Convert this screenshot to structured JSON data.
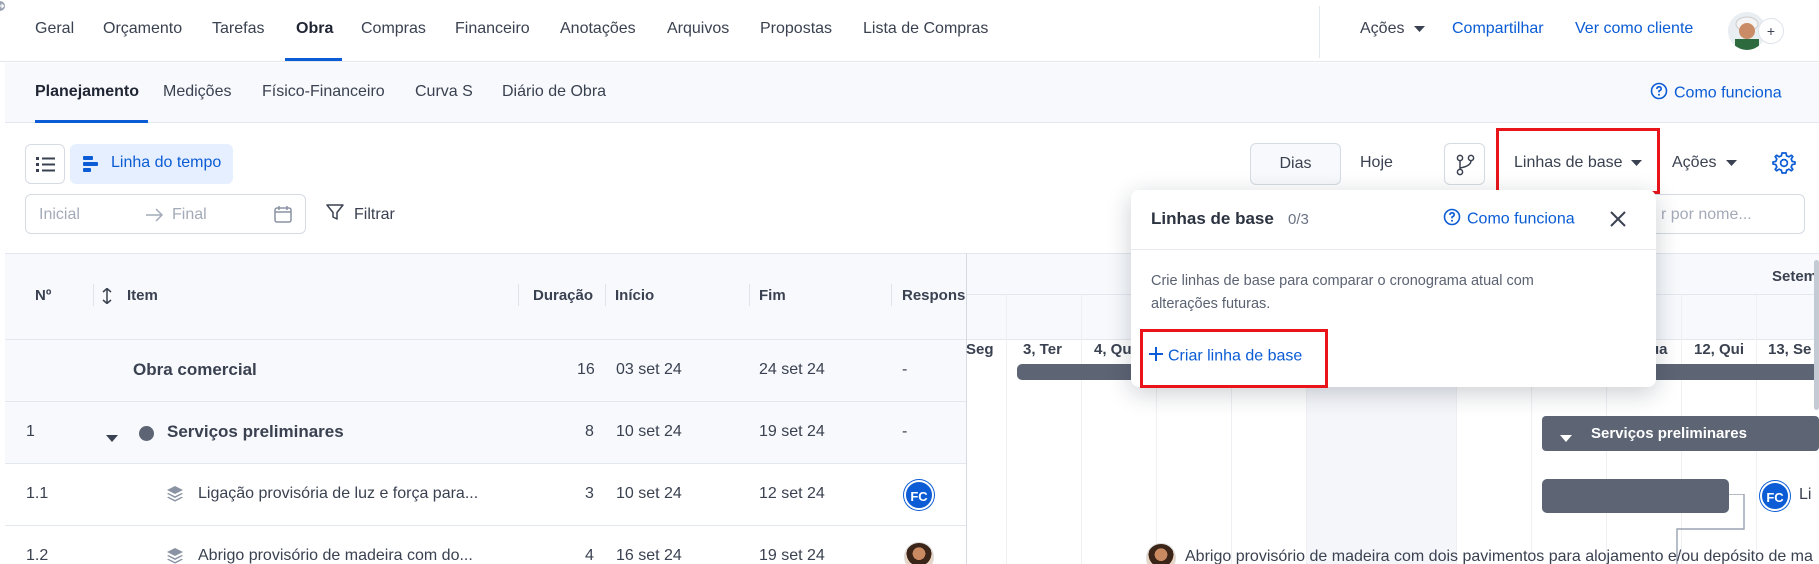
{
  "top_nav": {
    "tabs": [
      "Geral",
      "Orçamento",
      "Tarefas",
      "Obra",
      "Compras",
      "Financeiro",
      "Anotações",
      "Arquivos",
      "Propostas",
      "Lista de Compras"
    ],
    "actions_label": "Ações",
    "share_label": "Compartilhar",
    "view_as_client_label": "Ver como cliente",
    "add_symbol": "+"
  },
  "sub_nav": {
    "tabs": [
      "Planejamento",
      "Medições",
      "Físico-Financeiro",
      "Curva S",
      "Diário de Obra"
    ],
    "how_it_works": "Como funciona"
  },
  "toolbar": {
    "timeline_label": "Linha do tempo",
    "date_start_placeholder": "Inicial",
    "date_end_placeholder": "Final",
    "filter_label": "Filtrar",
    "days_label": "Dias",
    "today_label": "Hoje",
    "baselines_label": "Linhas de base",
    "actions_label": "Ações",
    "search_placeholder_visible": "r por nome..."
  },
  "table": {
    "headers": {
      "num": "Nº",
      "item": "Item",
      "duration": "Duração",
      "start": "Início",
      "end": "Fim",
      "responsible": "Respons"
    },
    "rows": [
      {
        "num": "",
        "item": "Obra comercial",
        "duration": "16",
        "start": "03 set 24",
        "end": "24 set 24",
        "responsible": "-"
      },
      {
        "num": "1",
        "item": "Serviços preliminares",
        "duration": "8",
        "start": "10 set 24",
        "end": "19 set 24",
        "responsible": "-"
      },
      {
        "num": "1.1",
        "item": "Ligação provisória de luz e força para...",
        "duration": "3",
        "start": "10 set 24",
        "end": "12 set 24",
        "responsible": "FC"
      },
      {
        "num": "1.2",
        "item": "Abrigo provisório de madeira com do...",
        "duration": "4",
        "start": "16 set 24",
        "end": "19 set 24",
        "responsible": ""
      }
    ]
  },
  "gantt": {
    "month_label": "Setem",
    "days": [
      "Seg",
      "3, Ter",
      "4, Qu",
      "ua",
      "12, Qui",
      "13, Se"
    ],
    "group_bar_label": "Serviços preliminares",
    "task_label_fc": "FC",
    "task_label_partial": "Li",
    "task_1_2_label": "Abrigo provisório de madeira com dois pavimentos para alojamento e/ou depósito de ma"
  },
  "popover": {
    "title": "Linhas de base",
    "count": "0/3",
    "how_it_works": "Como funciona",
    "description": "Crie linhas de base para comparar o cronograma atual com alterações futuras.",
    "create_label": "Criar linha de base"
  },
  "colors": {
    "accent": "#0b5cd5",
    "highlight": "#e8141a",
    "bar": "#5d6474"
  }
}
